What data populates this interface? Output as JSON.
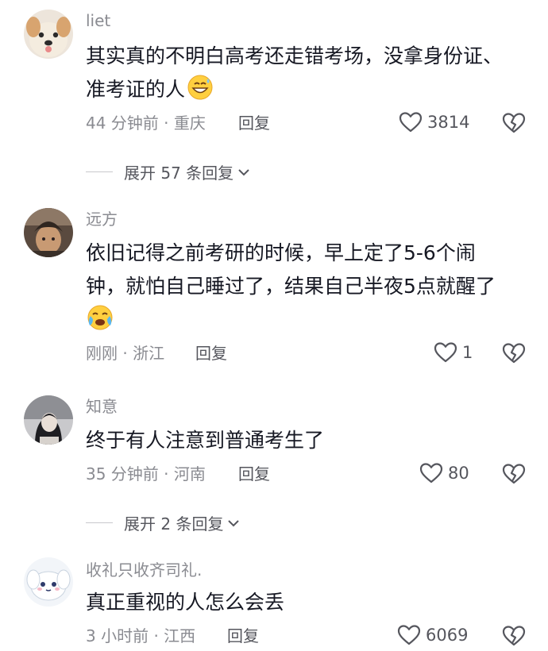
{
  "comments": [
    {
      "username": "liet",
      "content": "其实真的不明白高考还走错考场，没拿身份证、准考证的人",
      "emoji": "grinning-sweat-emoji",
      "time_location": "44 分钟前 · 重庆",
      "reply_label": "回复",
      "like_count": "3814",
      "expand_label": "展开 57 条回复"
    },
    {
      "username": "远方",
      "content": "依旧记得之前考研的时候，早上定了5-6个闹钟，就怕自己睡过了，结果自己半夜5点就醒了",
      "emoji": "crying-laughing-emoji",
      "time_location": "刚刚 · 浙江",
      "reply_label": "回复",
      "like_count": "1"
    },
    {
      "username": "知意",
      "content": "终于有人注意到普通考生了",
      "time_location": "35 分钟前 · 河南",
      "reply_label": "回复",
      "like_count": "80",
      "expand_label": "展开 2 条回复"
    },
    {
      "username": "收礼只收齐司礼.",
      "content": "真正重视的人怎么会丢",
      "time_location": "3 小时前 · 江西",
      "reply_label": "回复",
      "like_count": "6069"
    }
  ],
  "icons": {
    "like": "heart-outline-icon",
    "dislike": "broken-heart-icon",
    "expand": "chevron-down-icon"
  },
  "colors": {
    "text": "#161823",
    "muted": "#8a8b91",
    "action": "#55565d"
  }
}
